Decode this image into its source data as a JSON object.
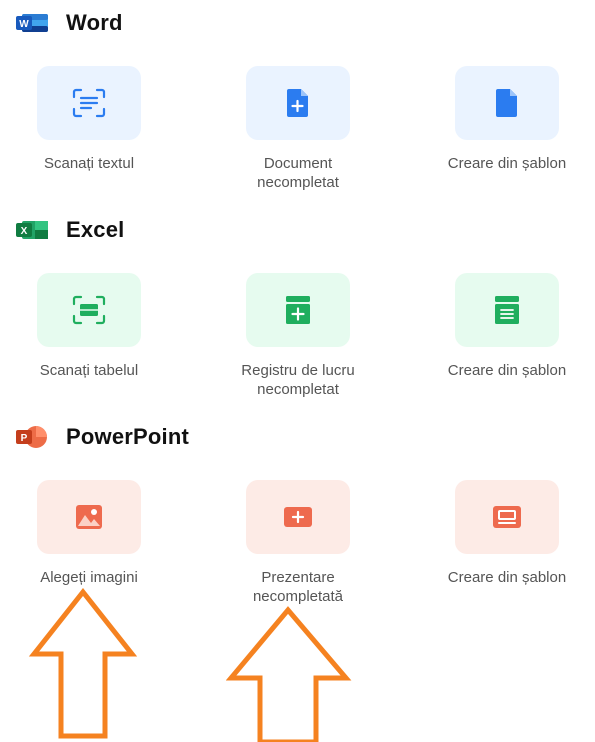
{
  "colors": {
    "word": "#2b7cf0",
    "excel": "#1fae5e",
    "ppt": "#ee6a4e",
    "arrow": "#f58220"
  },
  "sections": [
    {
      "title": "Word",
      "logo_letter": "W",
      "items": [
        {
          "label": "Scanați textul",
          "icon": "scan-text-icon"
        },
        {
          "label": "Document\nnecompletat",
          "icon": "new-document-icon"
        },
        {
          "label": "Creare din șablon",
          "icon": "document-template-icon"
        }
      ]
    },
    {
      "title": "Excel",
      "logo_letter": "X",
      "items": [
        {
          "label": "Scanați tabelul",
          "icon": "scan-table-icon"
        },
        {
          "label": "Registru de lucru\nnecompletat",
          "icon": "new-workbook-icon"
        },
        {
          "label": "Creare din șablon",
          "icon": "workbook-template-icon"
        }
      ]
    },
    {
      "title": "PowerPoint",
      "logo_letter": "P",
      "items": [
        {
          "label": "Alegeți imagini",
          "icon": "image-icon"
        },
        {
          "label": "Prezentare\nnecompletată",
          "icon": "new-presentation-icon"
        },
        {
          "label": "Creare din șablon",
          "icon": "presentation-template-icon"
        }
      ]
    }
  ],
  "annotations": [
    "up-arrow-icon",
    "up-arrow-icon"
  ]
}
